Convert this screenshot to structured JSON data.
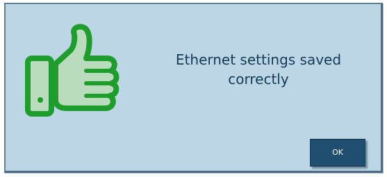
{
  "dialog": {
    "icon": "thumbs-up-icon",
    "icon_color": "#2db82d",
    "message": "Ethernet settings saved correctly",
    "ok_label": "OK"
  },
  "colors": {
    "background": "#bdd6e6",
    "border": "#5f7f97",
    "text": "#143a56",
    "button": "#1f4e70"
  }
}
